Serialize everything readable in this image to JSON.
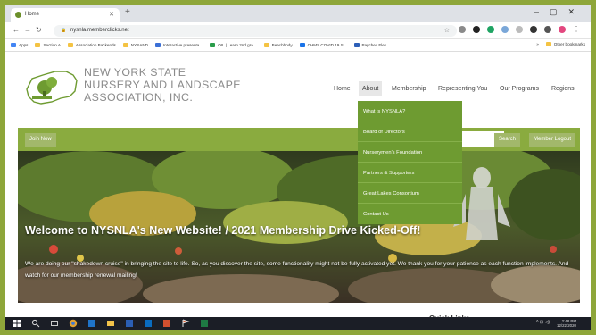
{
  "browser": {
    "tab_title": "Home",
    "url": "nysnla.memberclicks.net",
    "bookmarks": [
      "Apps",
      "Section A",
      "Association Backends",
      "NYSAND",
      "Interactive presenta...",
      "OIL | Learn 2nd gra...",
      "Beachbody",
      "CHMS COVID 19 S...",
      "Paychex Flex"
    ],
    "other_bookmarks": "Other bookmarks"
  },
  "site": {
    "logo_line1": "NEW YORK STATE",
    "logo_line2": "NURSERY AND LANDSCAPE",
    "logo_line3": "ASSOCIATION, INC.",
    "nav": [
      "Home",
      "About",
      "Membership",
      "Representing You",
      "Our Programs",
      "Regions"
    ],
    "active_nav": "About",
    "dropdown": [
      "What is NYSNLA?",
      "Board of Directors",
      "Nurserymen's Foundation",
      "Partners & Supporters",
      "Great Lakes Consortium",
      "Contact Us"
    ],
    "join_label": "Join Now",
    "search_label": "Search",
    "logout_label": "Member Logout"
  },
  "hero": {
    "headline": "Welcome to NYSNLA's New Website! / 2021 Membership Drive Kicked-Off!",
    "body": "We are doing our \"shakedown cruise\" in bringing the site to life. So, as you discover the site, some functionality might not be fully activated yet. We thank you for your patience as each function implements.  And watch for our membership renewal mailing!"
  },
  "quick_links": "Quick Links",
  "taskbar": {
    "time": "2:48 PM",
    "date": "12/22/2020"
  },
  "colors": {
    "frame": "#8ea63a",
    "nav_green": "#6e9b31",
    "bar_green": "#8aab3f"
  }
}
